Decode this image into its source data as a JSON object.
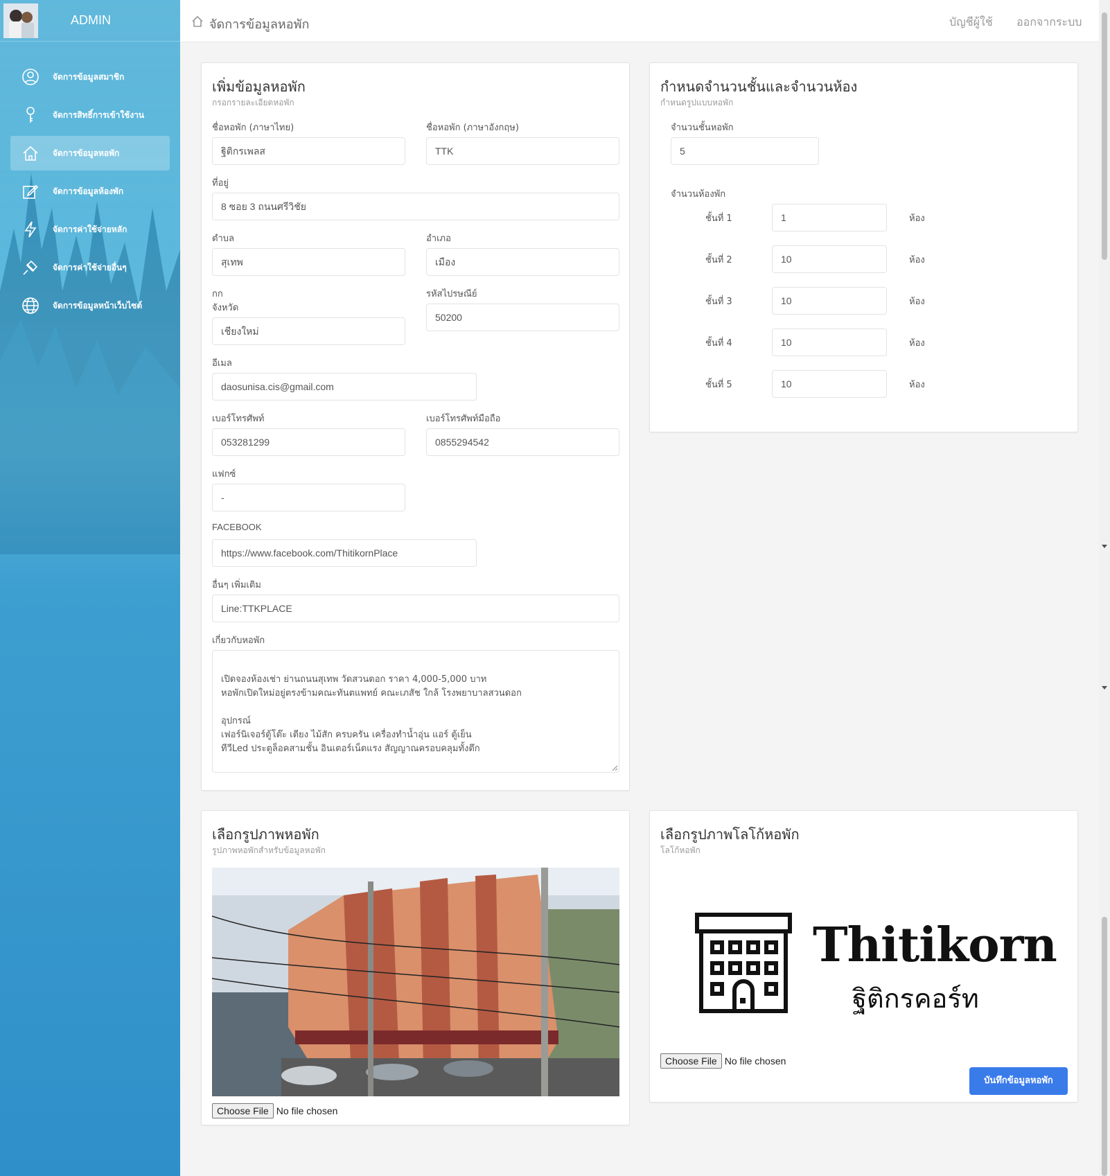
{
  "sidebar": {
    "title": "ADMIN",
    "items": [
      {
        "label": "จัดการข้อมูลสมาชิก"
      },
      {
        "label": "จัดการสิทธิ์การเข้าใช้งาน"
      },
      {
        "label": "จัดการข้อมูลหอพัก"
      },
      {
        "label": "จัดการข้อมูลห้องพัก"
      },
      {
        "label": "จัดการค่าใช้จ่ายหลัก"
      },
      {
        "label": "จัดการค่าใช้จ่ายอื่นๆ"
      },
      {
        "label": "จัดการข้อมูลหน้าเว็บไซต์"
      }
    ],
    "active_index": 2
  },
  "topbar": {
    "breadcrumb": "จัดการข้อมูลหอพัก",
    "account_link": "บัญชีผู้ใช้",
    "logout_link": "ออกจากระบบ"
  },
  "dorm_form": {
    "title": "เพิ่มข้อมูลหอพัก",
    "subtitle": "กรอกรายละเอียดหอพัก",
    "name_th_label": "ชื่อหอพัก (ภาษาไทย)",
    "name_th": "ฐิติกรเพลส",
    "name_en_label": "ชื่อหอพัก (ภาษาอังกฤษ)",
    "name_en": "TTK",
    "address_label": "ที่อยู่",
    "address": "8 ซอย 3 ถนนศรีวิชัย",
    "subdistrict_label": "ตำบล",
    "subdistrict": "สุเทพ",
    "district_label": "อำเภอ",
    "district": "เมือง",
    "stray_text": "กก",
    "province_label": "จังหวัด",
    "province": "เชียงใหม่",
    "postcode_label": "รหัสไปรษณีย์",
    "postcode": "50200",
    "email_label": "อีเมล",
    "email": "daosunisa.cis@gmail.com",
    "phone_label": "เบอร์โทรศัพท์",
    "phone": "053281299",
    "mobile_label": "เบอร์โทรศัพท์มือถือ",
    "mobile": "0855294542",
    "fax_label": "แฟกซ์",
    "fax": "-",
    "facebook_label": "FACEBOOK",
    "facebook": "https://www.facebook.com/ThitikornPlace",
    "other_label": "อื่นๆ เพิ่มเติม",
    "other": "Line:TTKPLACE",
    "about_label": "เกี่ยวกับหอพัก",
    "about": "เปิดจองห้องเช่า ย่านถนนสุเทพ วัดสวนดอก ราคา 4,000-5,000 บาท\nหอพักเปิดใหม่อยู่ตรงข้ามคณะทันตแพทย์ คณะเภสัช ใกล้ โรงพยาบาลสวนดอก\n\nอุปกรณ์\nเฟอร์นิเจอร์ตู้โต๊ะ เตียง ไม้สัก ครบครัน เครื่องทำน้ำอุ่น แอร์ ตู้เย็น\nทีวีLed ประตูล็อคสามชั้น อินเตอร์เน็ตแรง สัญญาณครอบคลุมทั้งตึก"
  },
  "floors_form": {
    "title": "กำหนดจำนวนชั้นและจำนวนห้อง",
    "subtitle": "กำหนดรูปแบบหอพัก",
    "floors_label": "จำนวนชั้นหอพัก",
    "floors_value": "5",
    "rooms_label": "จำนวนห้องพัก",
    "unit": "ห้อง",
    "floors": [
      {
        "label": "ชั้นที่ 1",
        "rooms": "1"
      },
      {
        "label": "ชั้นที่ 2",
        "rooms": "10"
      },
      {
        "label": "ชั้นที่ 3",
        "rooms": "10"
      },
      {
        "label": "ชั้นที่ 4",
        "rooms": "10"
      },
      {
        "label": "ชั้นที่ 5",
        "rooms": "10"
      }
    ]
  },
  "photo_card": {
    "title": "เลือกรูปภาพหอพัก",
    "subtitle": "รูปภาพหอพักสำหรับข้อมูลหอพัก",
    "choose_file": "Choose File",
    "no_file": "No file chosen"
  },
  "logo_card": {
    "title": "เลือกรูปภาพโลโก้หอพัก",
    "subtitle": "โลโก้หอพัก",
    "logo_name_en": "Thitikorn",
    "logo_name_th": "ฐิติกรคอร์ท",
    "choose_file": "Choose File",
    "no_file": "No file chosen",
    "save_button": "บันทึกข้อมูลหอพัก"
  },
  "colors": {
    "sidebar_blue": "#3d9fd0",
    "primary_button": "#3a7bea"
  }
}
